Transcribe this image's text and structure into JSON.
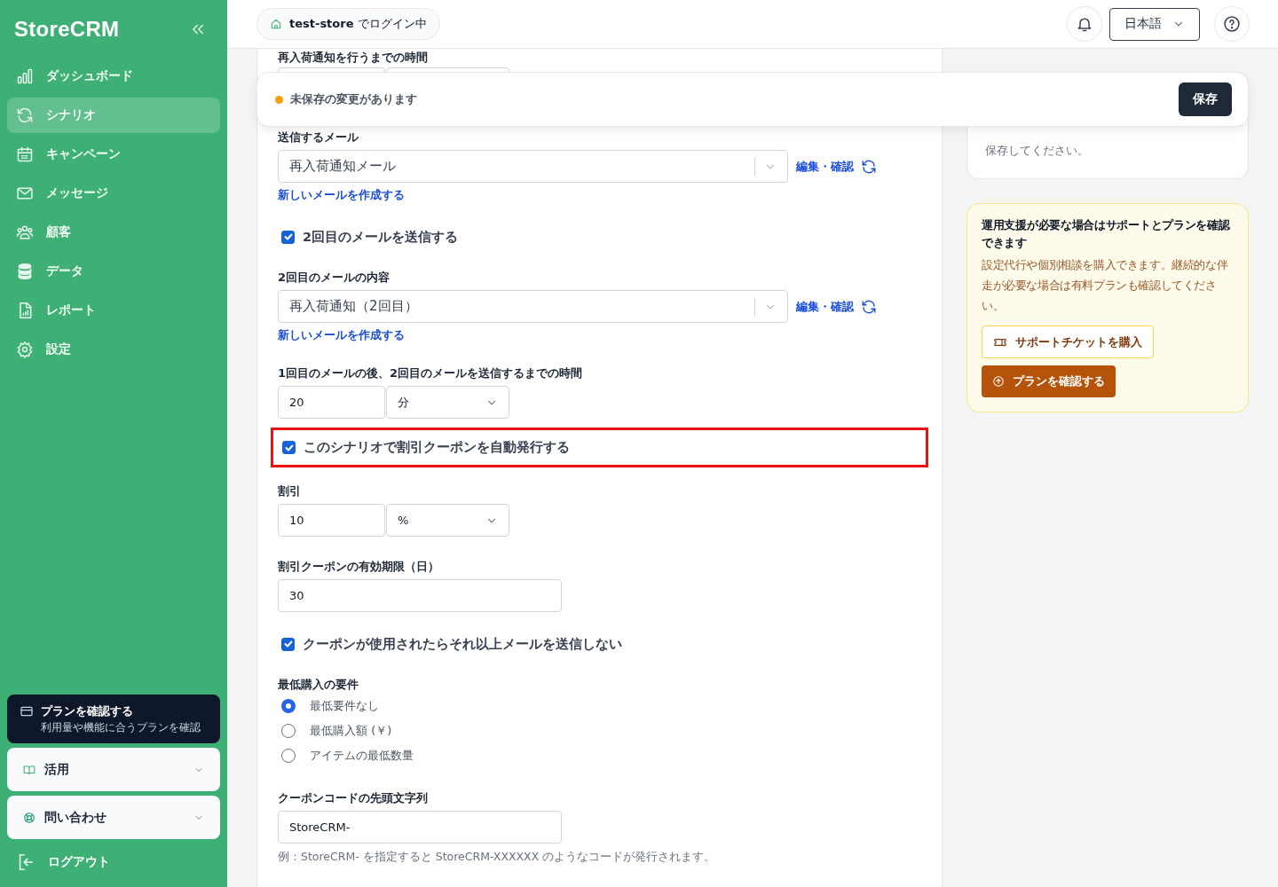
{
  "sidebar": {
    "logo": "StoreCRM",
    "nav": [
      {
        "label": "ダッシュボード",
        "selected": false
      },
      {
        "label": "シナリオ",
        "selected": true
      },
      {
        "label": "キャンペーン",
        "selected": false
      },
      {
        "label": "メッセージ",
        "selected": false
      },
      {
        "label": "顧客",
        "selected": false
      },
      {
        "label": "データ",
        "selected": false
      },
      {
        "label": "レポート",
        "selected": false
      },
      {
        "label": "設定",
        "selected": false
      }
    ],
    "plan_card": {
      "title": "プランを確認する",
      "subtitle": "利用量や機能に合うプランを確認"
    },
    "accordions": [
      {
        "label": "活用",
        "expanded": false
      },
      {
        "label": "問い合わせ",
        "expanded": false
      }
    ],
    "logout": "ログアウト"
  },
  "header": {
    "store": "**test-store** でログイン中",
    "language": "日本語"
  },
  "unsaved_bar": {
    "message": "未保存の変更があります",
    "save_button": "保存"
  },
  "form": {
    "items": [
      {
        "kind": "label",
        "text": "再入荷通知を行うまでの時間"
      },
      {
        "kind": "number_unit"
      },
      {
        "kind": "label",
        "text": "送信するメール"
      },
      {
        "kind": "select",
        "value": "再入荷通知メール",
        "link": "編集・確認"
      },
      {
        "kind": "link",
        "text": "新しいメールを作成する"
      },
      {
        "kind": "checkbox",
        "text": "2回目のメールを送信する",
        "checked": true,
        "highlighted": false
      },
      {
        "kind": "label",
        "text": "2回目のメールの内容"
      },
      {
        "kind": "select",
        "value": "再入荷通知（2回目）",
        "link": "編集・確認"
      },
      {
        "kind": "link",
        "text": "新しいメールを作成する"
      },
      {
        "kind": "label",
        "text": "1回目のメールの後、2回目のメールを送信するまでの時間"
      },
      {
        "kind": "number_unit",
        "value": "20",
        "unit": "分"
      },
      {
        "kind": "checkbox",
        "text": "このシナリオで割引クーポンを自動発行する",
        "checked": true,
        "highlighted": true
      },
      {
        "kind": "label",
        "text": "割引"
      },
      {
        "kind": "number_unit",
        "value": "10",
        "unit": "%"
      },
      {
        "kind": "label",
        "text": "割引クーポンの有効期限（日）"
      },
      {
        "kind": "text_input",
        "value": "30"
      },
      {
        "kind": "checkbox",
        "text": "クーポンが使用されたらそれ以上メールを送信しない",
        "checked": true,
        "highlighted": false
      },
      {
        "kind": "label",
        "text": "最低購入の要件"
      },
      {
        "kind": "radio",
        "options": [
          {
            "label": "最低要件なし",
            "selected": true
          },
          {
            "label": "最低購入額 (￥)",
            "selected": false
          },
          {
            "label": "アイテムの最低数量",
            "selected": false
          }
        ]
      },
      {
        "kind": "label",
        "text": "クーポンコードの先頭文字列"
      },
      {
        "kind": "text_input",
        "value": "StoreCRM-"
      },
      {
        "kind": "hint",
        "text": "例：StoreCRM- を指定すると StoreCRM-XXXXXX のようなコードが発行されます。"
      }
    ]
  },
  "right_panel": {
    "info_text": "保存してください。",
    "support": {
      "title": "運用支援が必要な場合はサポートとプランを確認できます",
      "body": "設定代行や個別相談を購入できます。継続的な伴走が必要な場合は有料プランも確認してください。",
      "ticket_button": "サポートチケットを購入",
      "plan_button": "プランを確認する"
    }
  }
}
